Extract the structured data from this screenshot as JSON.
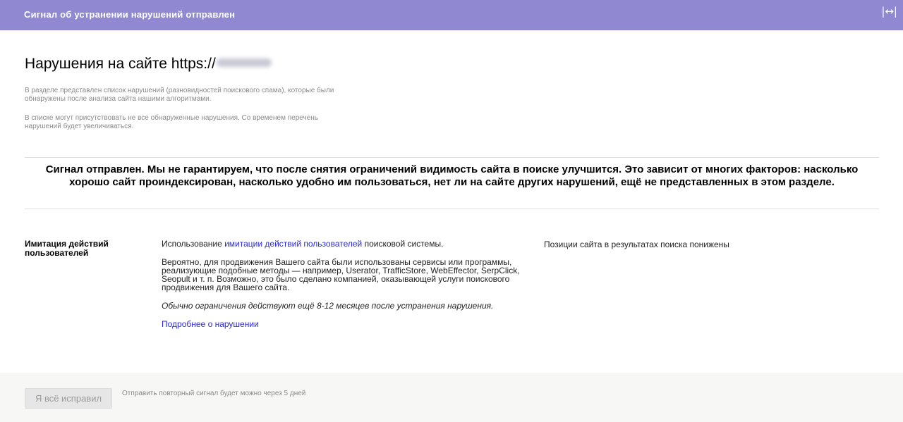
{
  "header": {
    "title": "Сигнал об устранении нарушений отправлен",
    "expand_icon": "expand-horizontal-icon",
    "expand_glyph": "|↔|",
    "background": "#9088d1"
  },
  "page": {
    "title_prefix": "Нарушения на сайте https://",
    "intro_1": "В разделе представлен список нарушений (разновидностей поискового спама), которые были обнаружены после анализа сайта нашими алгоритмами.",
    "intro_2": "В списке могут присутствовать не все обнаруженные нарушения. Со временем перечень нарушений будет увеличиваться."
  },
  "notice": "Сигнал отправлен. Мы не гарантируем, что после снятия ограничений видимость сайта в поиске улучшится. Это зависит от многих факторов: насколько хорошо сайт проиндексирован, насколько удобно им пользоваться, нет ли на сайте других нарушений, ещё не представленных в этом разделе.",
  "violation": {
    "name": "Имитация действий пользователей",
    "desc_prefix": "Использование ",
    "desc_link": "имитации действий пользователей",
    "desc_suffix": " поисковой системы.",
    "details": "Вероятно, для продвижения Вашего сайта были использованы сервисы или программы, реализующие подобные методы — например, Userator, TrafficStore, WebEffector, SerpClick, Seopult и т. п. Возможно, это было сделано компанией, оказывающей услуги поискового продвижения для Вашего сайта.",
    "restriction_note": "Обычно ограничения действуют ещё 8-12 месяцев после устранения нарушения.",
    "more_link": "Подробнее о нарушении",
    "consequence": "Позиции сайта в результатах поиска понижены"
  },
  "footer": {
    "fix_button": "Я всё исправил",
    "note": "Отправить повторный сигнал будет можно через 5 дней"
  },
  "colors": {
    "link": "#2b2bd1",
    "muted_text": "#8a8a8a"
  }
}
